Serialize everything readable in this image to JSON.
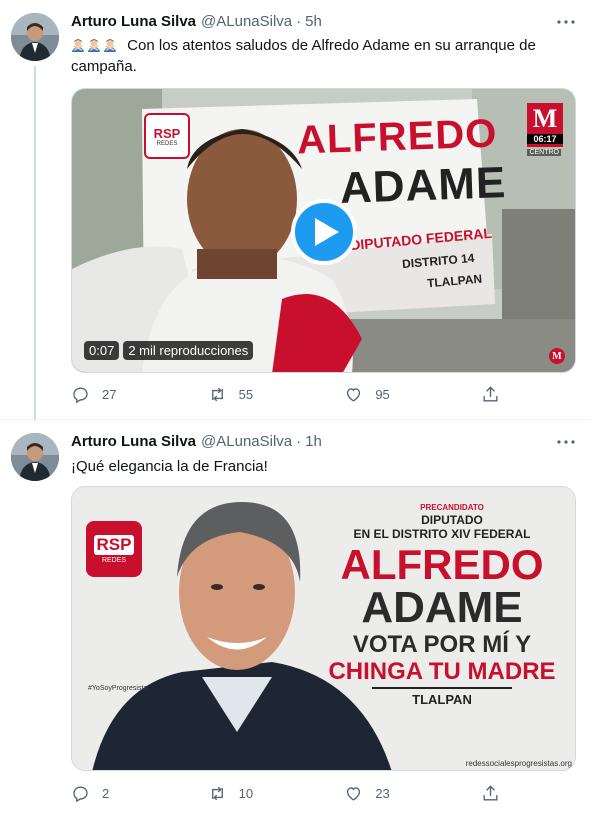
{
  "tweets": [
    {
      "author_name": "Arturo Luna Silva",
      "handle": "@ALunaSilva",
      "separator": "·",
      "time": "5h",
      "text": "Con los atentos saludos de Alfredo Adame en su arranque de campaña.",
      "emoji_count": 3,
      "media": {
        "type": "video",
        "duration": "0:07",
        "views": "2 mil reproducciones",
        "banner_lines": [
          "ALFREDO",
          "ADAME",
          "DIPUTADO FEDERAL",
          "DISTRITO 14",
          "TLALPAN"
        ],
        "logo_letters": "RSP",
        "logo_sub": "REDES",
        "channel_logo": "M",
        "channel_time": "06:17",
        "channel_label": "CENTRO"
      },
      "replies": "27",
      "retweets": "55",
      "likes": "95"
    },
    {
      "author_name": "Arturo Luna Silva",
      "handle": "@ALunaSilva",
      "separator": "·",
      "time": "1h",
      "text": "¡Qué elegancia la de Francia!",
      "media": {
        "type": "image",
        "logo_letters": "RSP",
        "logo_sub": "REDES",
        "hashtag": "#YoSoyProgresista",
        "precandidato": "PRECANDIDATO",
        "diputado": "DIPUTADO",
        "distrito": "EN EL DISTRITO XIV FEDERAL",
        "name_first": "ALFREDO",
        "name_last": "ADAME",
        "slogan_1": "VOTA POR MÍ Y",
        "slogan_2": "CHINGA TU MADRE",
        "place": "TLALPAN",
        "website": "redessocialesprogresistas.org"
      },
      "replies": "2",
      "retweets": "10",
      "likes": "23"
    }
  ],
  "colors": {
    "accent": "#1d9bf0",
    "muted": "#536471",
    "text": "#0f1419",
    "brand_red": "#c8102e"
  },
  "icons": {
    "reply": "reply-icon",
    "retweet": "retweet-icon",
    "like": "heart-icon",
    "share": "share-icon",
    "more": "more-icon",
    "play": "play-icon"
  }
}
